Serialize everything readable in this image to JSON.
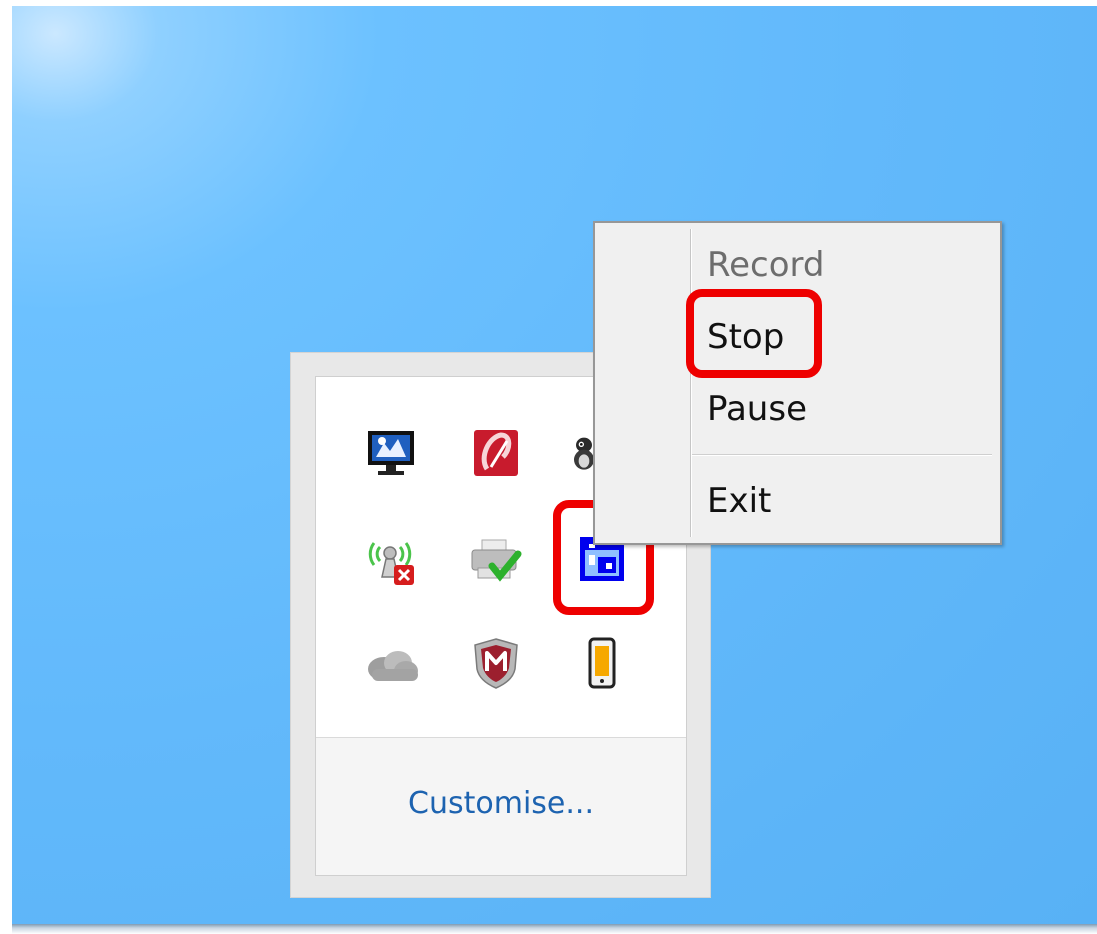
{
  "tray": {
    "customise_label": "Customise...",
    "icons": [
      "network-monitor-icon",
      "red-app-icon",
      "mascot-icon",
      "wireless-disconnected-icon",
      "printer-ok-icon",
      "recorder-app-icon",
      "cloud-storage-icon",
      "security-shield-icon",
      "phone-battery-icon"
    ]
  },
  "context_menu": {
    "items": [
      {
        "label": "Record",
        "enabled": false
      },
      {
        "label": "Stop",
        "enabled": true
      },
      {
        "label": "Pause",
        "enabled": true
      },
      {
        "label": "Exit",
        "enabled": true
      }
    ]
  },
  "colors": {
    "highlight": "#ee0000",
    "link": "#1d63b0",
    "desktop": "#62b9fb"
  }
}
